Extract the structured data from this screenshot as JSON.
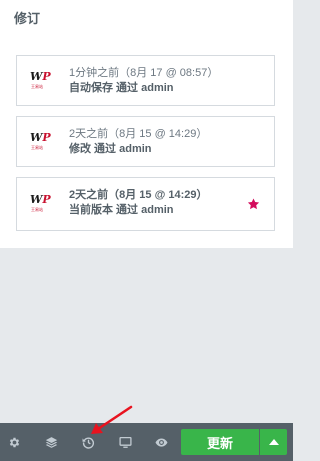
{
  "panel": {
    "title": "修订"
  },
  "revisions": [
    {
      "line1": "1分钟之前（8月 17 @ 08:57）",
      "line2": "自动保存 通过 admin",
      "current": false
    },
    {
      "line1": "2天之前（8月 15 @ 14:29）",
      "line2": "修改 通过 admin",
      "current": false
    },
    {
      "line1": "2天之前（8月 15 @ 14:29）",
      "line2": "当前版本 通过 admin",
      "current": true
    }
  ],
  "avatar": {
    "logo_w": "W",
    "logo_p": "P",
    "logo_tag": "王易站"
  },
  "toolbar": {
    "update_label": "更新",
    "icons": [
      "gear-icon",
      "layers-icon",
      "history-icon",
      "desktop-icon",
      "eye-icon"
    ]
  },
  "colors": {
    "accent_green": "#39b54a",
    "toolbar_bg": "#556068",
    "star": "#d30c5c",
    "annotation_arrow": "#e8131f"
  }
}
